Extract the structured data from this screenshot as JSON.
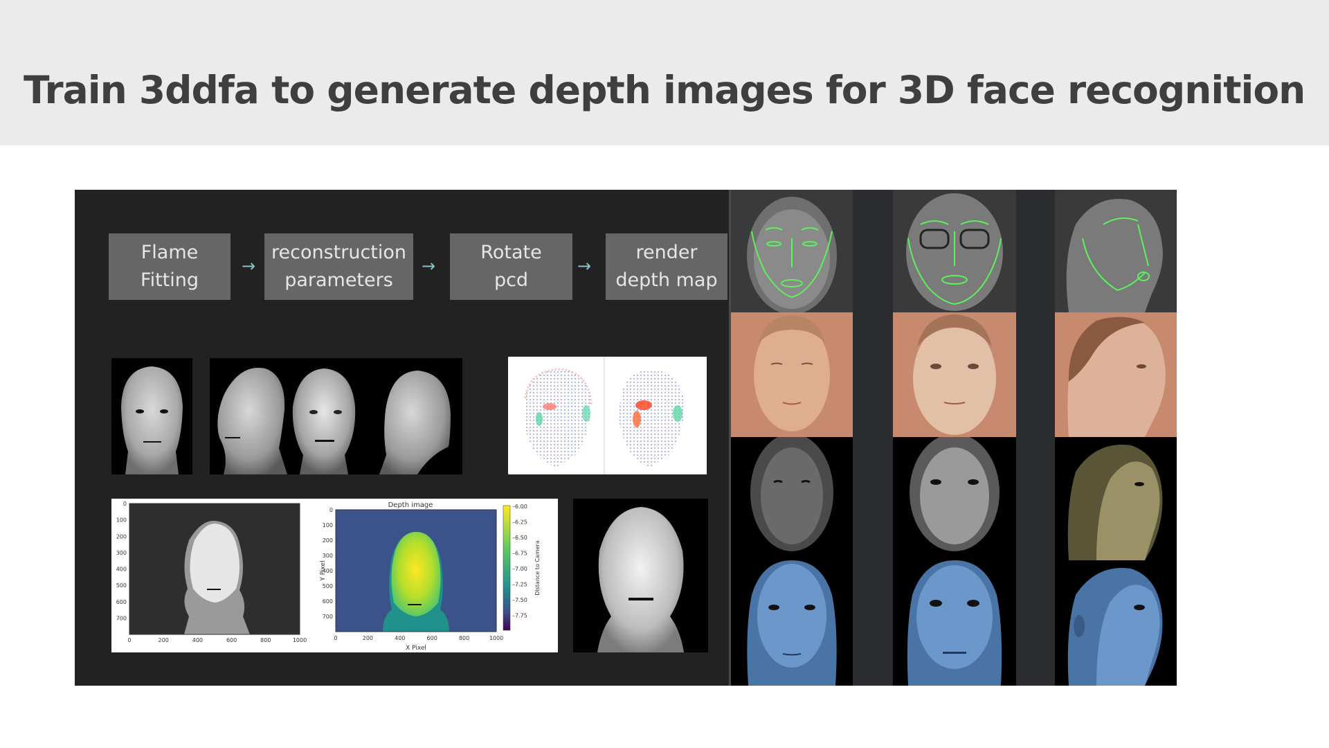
{
  "slide": {
    "title": "Train 3ddfa to generate depth images for 3D face recognition"
  },
  "pipeline": {
    "steps": [
      {
        "line1": "Flame",
        "line2": "Fitting"
      },
      {
        "line1": "reconstruction",
        "line2": "parameters"
      },
      {
        "line1": "Rotate",
        "line2": "pcd"
      },
      {
        "line1": "render",
        "line2": "depth map"
      }
    ],
    "arrow": "→"
  },
  "gray_plot": {
    "y_ticks": [
      "0",
      "100",
      "200",
      "300",
      "400",
      "500",
      "600",
      "700"
    ],
    "x_ticks": [
      "0",
      "200",
      "400",
      "600",
      "800",
      "1000"
    ]
  },
  "depth_plot": {
    "title": "Depth image",
    "xlabel": "X Pixel",
    "ylabel": "Y Pixel",
    "colorbar_label": "Distance to Camera",
    "y_ticks": [
      "0",
      "100",
      "200",
      "300",
      "400",
      "500",
      "600",
      "700"
    ],
    "x_ticks": [
      "0",
      "200",
      "400",
      "600",
      "800",
      "1000"
    ],
    "colorbar_ticks": [
      "-6.00",
      "-6.25",
      "-6.50",
      "-6.75",
      "-7.00",
      "-7.25",
      "-7.50",
      "-7.75"
    ],
    "colors": {
      "background": "#3b528b",
      "face_high": "#fde725",
      "face_mid": "#5ec962",
      "neck": "#21918c"
    }
  },
  "colors": {
    "header_bg": "#ebebeb",
    "title_text": "#3f3f3f",
    "figure_bg": "#222222",
    "step_box": "#666666",
    "landmark_green": "#5cf25c",
    "skin_bg": "#c88a6e",
    "shaded_blue": "#5a86b8"
  }
}
